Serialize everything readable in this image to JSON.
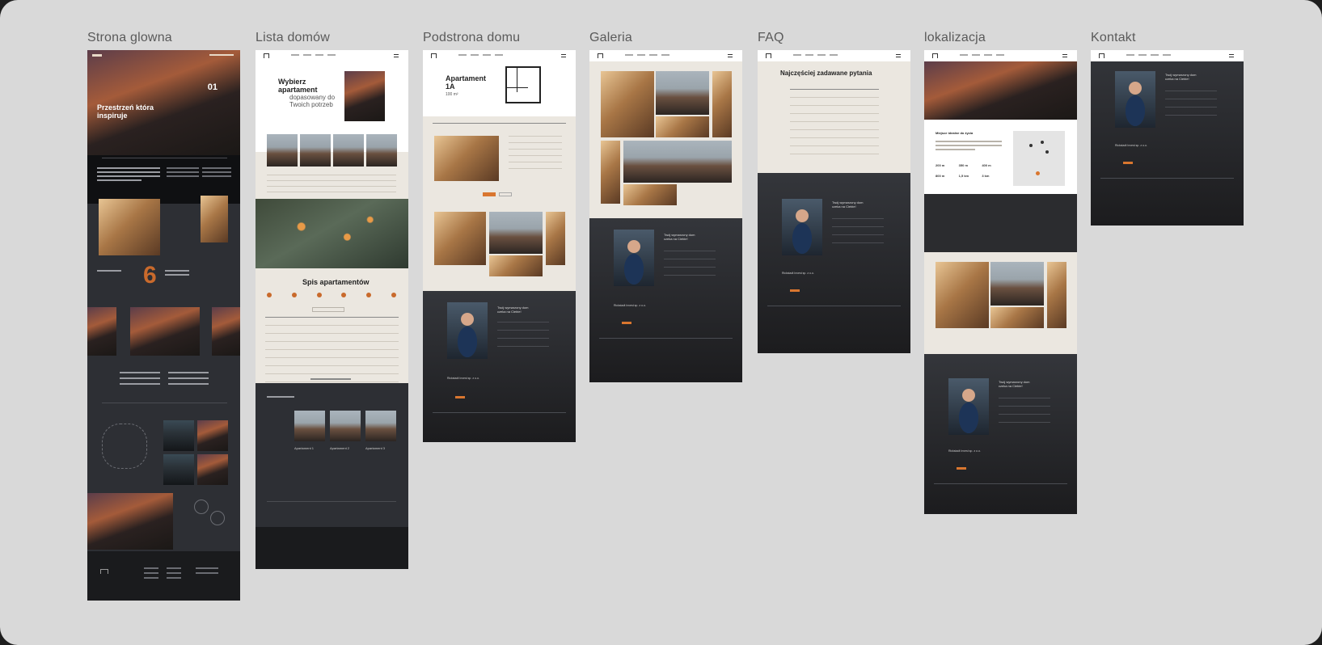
{
  "frames": [
    {
      "id": "home",
      "title": "Strona glowna"
    },
    {
      "id": "list",
      "title": "Lista domów"
    },
    {
      "id": "house",
      "title": "Podstrona domu"
    },
    {
      "id": "gallery",
      "title": "Galeria"
    },
    {
      "id": "faq",
      "title": "FAQ"
    },
    {
      "id": "location",
      "title": "lokalizacja"
    },
    {
      "id": "contact",
      "title": "Kontakt"
    }
  ],
  "home": {
    "hero_heading": "Przestrzeń która inspiruje",
    "slide_counter": "01",
    "stat_number": "6"
  },
  "list": {
    "hero_heading_1": "Wybierz",
    "hero_heading_2": "apartament",
    "hero_sub_1": "dopasowany do",
    "hero_sub_2": "Twoich potrzeb",
    "table_title": "Spis apartamentów",
    "cards": [
      "Apartament 1",
      "Apartament 2",
      "Apartament 3"
    ]
  },
  "house": {
    "title_1": "Apartament",
    "title_2": "1A",
    "area": "100 m²"
  },
  "faq": {
    "title": "Najczęściej zadawane pytania"
  },
  "location": {
    "title": "Miejsce idealne do życia",
    "stats": [
      "200 m",
      "350 m",
      "400 m",
      "800 m",
      "1,5 km",
      "3 km"
    ]
  },
  "contact_block": {
    "heading_1": "Twój wymarzony dom",
    "heading_2": "czeka na Ciebie!",
    "company": "Rickstadt Invest sp. z o.o."
  },
  "colors": {
    "canvas": "#d9d9d9",
    "dark": "#2d2f34",
    "beige": "#ebe7e0",
    "accent": "#d9762f"
  }
}
